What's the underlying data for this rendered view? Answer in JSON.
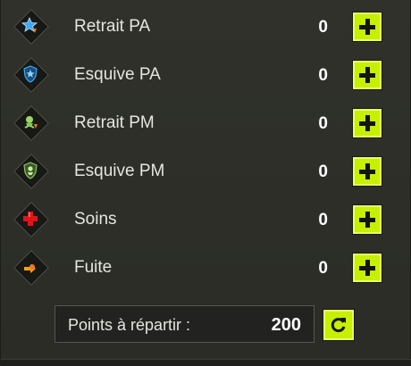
{
  "stats": [
    {
      "label": "Retrait PA",
      "value": "0",
      "icon": "ap-reduction-icon"
    },
    {
      "label": "Esquive PA",
      "value": "0",
      "icon": "ap-dodge-icon"
    },
    {
      "label": "Retrait PM",
      "value": "0",
      "icon": "mp-reduction-icon"
    },
    {
      "label": "Esquive PM",
      "value": "0",
      "icon": "mp-dodge-icon"
    },
    {
      "label": "Soins",
      "value": "0",
      "icon": "heal-icon"
    },
    {
      "label": "Fuite",
      "value": "0",
      "icon": "flee-icon"
    }
  ],
  "points": {
    "label": "Points à répartir :",
    "value": "200"
  },
  "colors": {
    "accent": "#c6f000",
    "heal": "#e0141a",
    "ap": "#3fa9f5",
    "mp": "#6fd14a"
  }
}
